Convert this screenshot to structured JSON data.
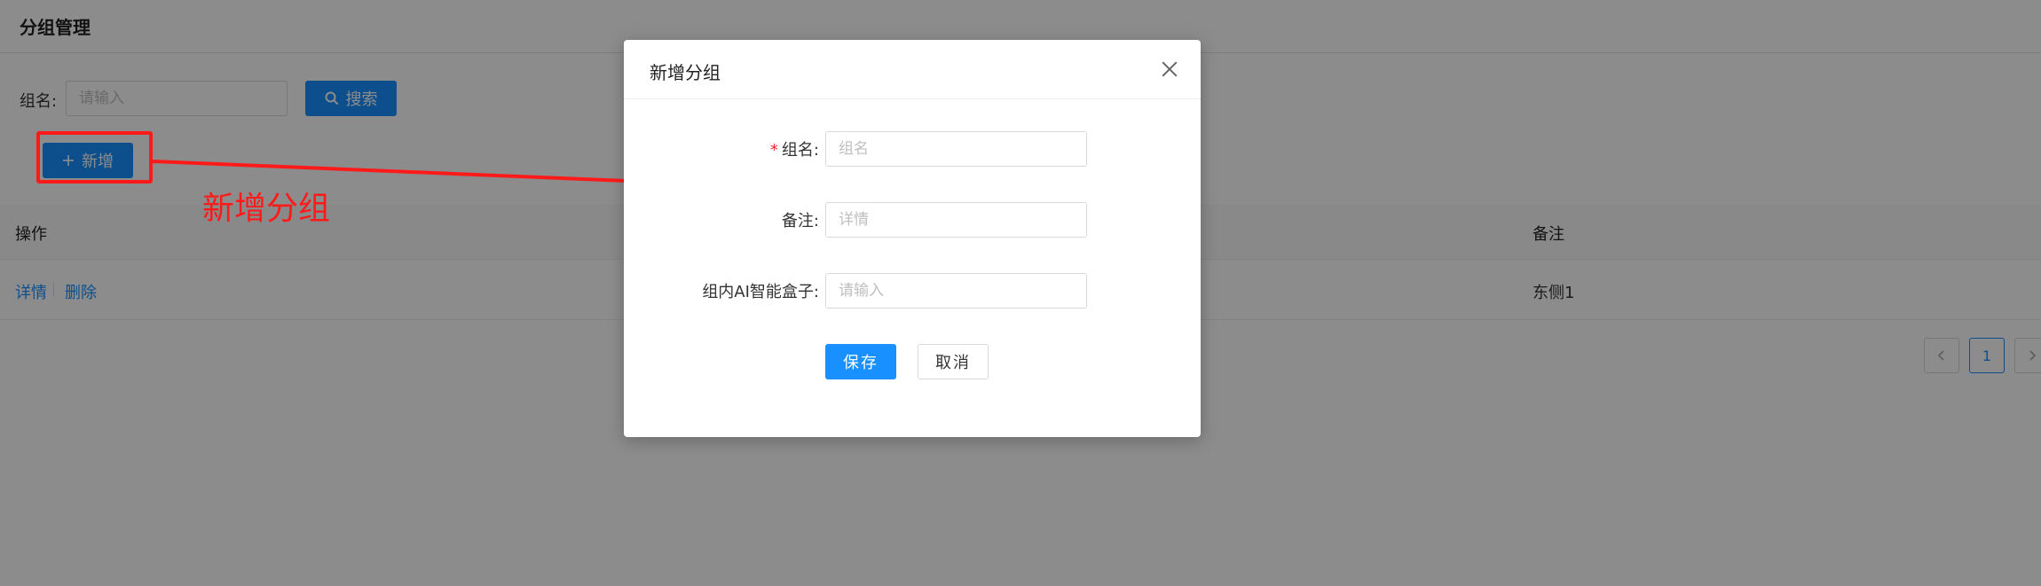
{
  "page": {
    "title": "分组管理",
    "filter": {
      "label": "组名:",
      "placeholder": "请输入",
      "search_label": "搜索"
    },
    "add_label": "新增",
    "table": {
      "headers": {
        "operation": "操作",
        "note": "备注"
      },
      "rows": [
        {
          "detail_link": "详情",
          "delete_link": "删除",
          "note": "东侧1"
        }
      ]
    },
    "pagination": {
      "current": "1"
    }
  },
  "annotation": {
    "text": "新增分组",
    "color": "#ff1a1a"
  },
  "modal": {
    "title": "新增分组",
    "fields": [
      {
        "label": "组名:",
        "placeholder": "组名",
        "required": true
      },
      {
        "label": "备注:",
        "placeholder": "详情",
        "required": false
      },
      {
        "label": "组内AI智能盒子:",
        "placeholder": "请输入",
        "required": false
      }
    ],
    "save_label": "保存",
    "cancel_label": "取消"
  },
  "colors": {
    "primary": "#1890ff",
    "danger": "#f5222d",
    "mask": "rgba(0,0,0,0.45)"
  },
  "icons": {
    "search": "search-icon",
    "add": "plus-icon",
    "close": "close-icon",
    "prev": "chevron-left-icon",
    "next": "chevron-right-icon"
  }
}
